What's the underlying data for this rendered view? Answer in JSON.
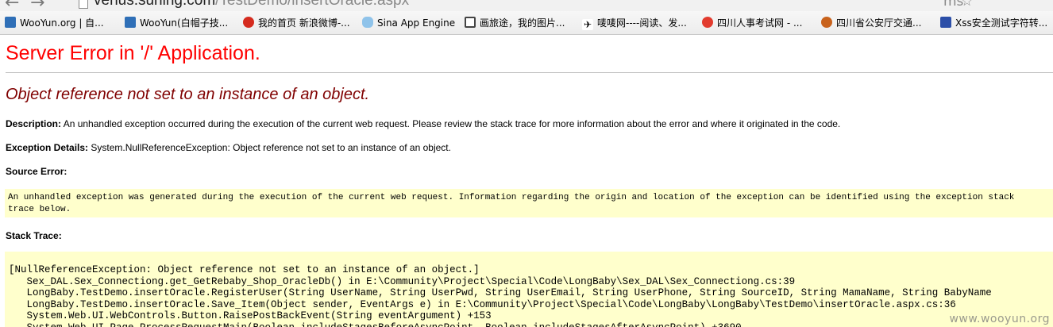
{
  "browser": {
    "url_host": "venus.suning.com",
    "url_path": "/TestDemo/insertOracle.aspx",
    "back_glyph": "←",
    "forward_glyph": "→",
    "right_items": [
      "ms",
      "☆"
    ]
  },
  "bookmarks": [
    {
      "label": "WooYun.org | 自...",
      "icon": "wooyun-icon"
    },
    {
      "label": "WooYun(白帽子技...",
      "icon": "wooyun-icon"
    },
    {
      "label": "我的首页 新浪微博-...",
      "icon": "weibo-icon"
    },
    {
      "label": "Sina App Engine",
      "icon": "cloud-icon"
    },
    {
      "label": "画旅途，我的图片...",
      "icon": "frame-icon"
    },
    {
      "label": "唛唛网----阅读、发...",
      "icon": "bird-icon"
    },
    {
      "label": "四川人事考试网 - ...",
      "icon": "red-circle-icon"
    },
    {
      "label": "四川省公安厅交通...",
      "icon": "police-seal-icon"
    },
    {
      "label": "Xss安全测试字符转...",
      "icon": "xss-icon"
    }
  ],
  "error": {
    "title": "Server Error in '/' Application.",
    "message": "Object reference not set to an instance of an object.",
    "description_label": "Description:",
    "description_text": " An unhandled exception occurred during the execution of the current web request. Please review the stack trace for more information about the error and where it originated in the code.",
    "details_label": "Exception Details:",
    "details_text": " System.NullReferenceException: Object reference not set to an instance of an object.",
    "source_label": "Source Error:",
    "source_text": "An unhandled exception was generated during the execution of the current web request. Information regarding the origin and location of the exception can be identified using the exception stack\ntrace below.",
    "stack_label": "Stack Trace:",
    "stack_text": "[NullReferenceException: Object reference not set to an instance of an object.]\n   Sex_DAL.Sex_Connectiong.get_GetRebaby_Shop_OracleDb() in E:\\Community\\Project\\Special\\Code\\LongBaby\\Sex_DAL\\Sex_Connectiong.cs:39\n   LongBaby.TestDemo.insertOracle.RegisterUser(String UserName, String UserPwd, String UserEmail, String UserPhone, String SourceID, String MamaName, String BabyName\n   LongBaby.TestDemo.insertOracle.Save_Item(Object sender, EventArgs e) in E:\\Community\\Project\\Special\\Code\\LongBaby\\LongBaby\\TestDemo\\insertOracle.aspx.cs:36\n   System.Web.UI.WebControls.Button.RaisePostBackEvent(String eventArgument) +153\n   System.Web.UI.Page.ProcessRequestMain(Boolean includeStagesBeforeAsyncPoint, Boolean includeStagesAfterAsyncPoint) +3690"
  },
  "watermark": "www.wooyun.org"
}
